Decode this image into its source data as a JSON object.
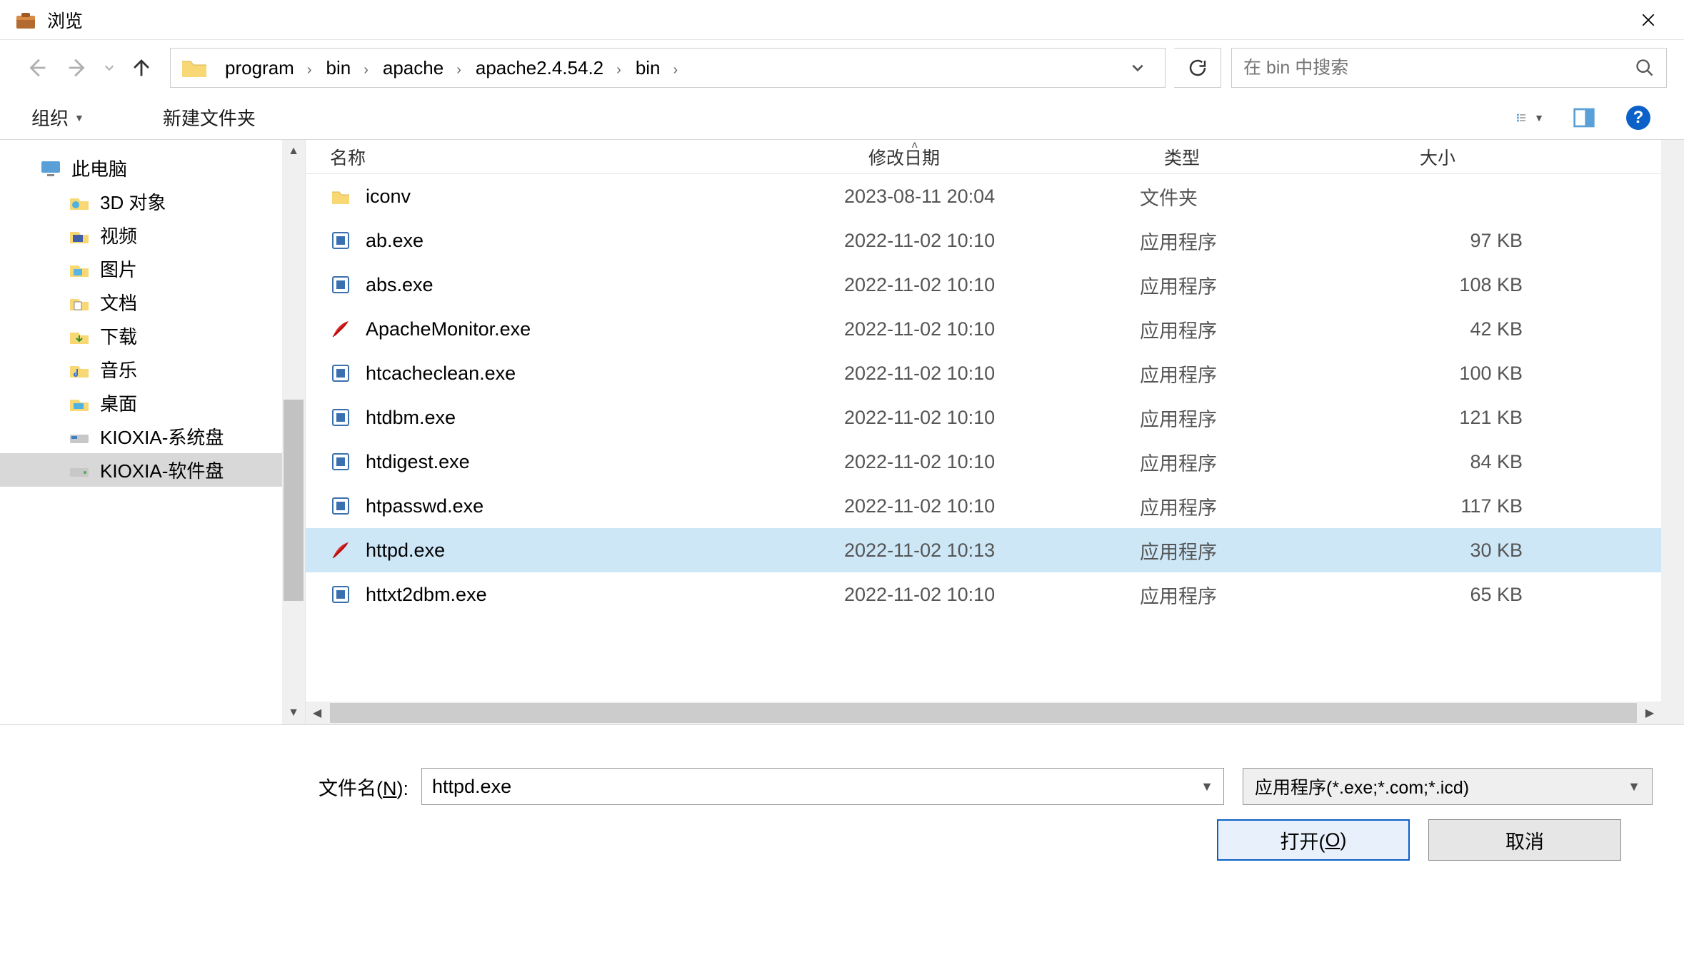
{
  "title": "浏览",
  "breadcrumbs": [
    "program",
    "bin",
    "apache",
    "apache2.4.54.2",
    "bin"
  ],
  "search_placeholder": "在 bin 中搜索",
  "toolbar": {
    "organize": "组织",
    "new_folder": "新建文件夹"
  },
  "columns": {
    "name": "名称",
    "date": "修改日期",
    "type": "类型",
    "size": "大小"
  },
  "tree": {
    "root": "此电脑",
    "items": [
      {
        "label": "3D 对象",
        "icon": "3d"
      },
      {
        "label": "视频",
        "icon": "video"
      },
      {
        "label": "图片",
        "icon": "pictures"
      },
      {
        "label": "文档",
        "icon": "documents"
      },
      {
        "label": "下载",
        "icon": "downloads"
      },
      {
        "label": "音乐",
        "icon": "music"
      },
      {
        "label": "桌面",
        "icon": "desktop"
      },
      {
        "label": "KIOXIA-系统盘",
        "icon": "ssd"
      },
      {
        "label": "KIOXIA-软件盘",
        "icon": "drive",
        "selected": true
      }
    ]
  },
  "files": [
    {
      "name": "iconv",
      "date": "2023-08-11 20:04",
      "type": "文件夹",
      "size": "",
      "icon": "folder"
    },
    {
      "name": "ab.exe",
      "date": "2022-11-02 10:10",
      "type": "应用程序",
      "size": "97 KB",
      "icon": "exe"
    },
    {
      "name": "abs.exe",
      "date": "2022-11-02 10:10",
      "type": "应用程序",
      "size": "108 KB",
      "icon": "exe"
    },
    {
      "name": "ApacheMonitor.exe",
      "date": "2022-11-02 10:10",
      "type": "应用程序",
      "size": "42 KB",
      "icon": "feather"
    },
    {
      "name": "htcacheclean.exe",
      "date": "2022-11-02 10:10",
      "type": "应用程序",
      "size": "100 KB",
      "icon": "exe"
    },
    {
      "name": "htdbm.exe",
      "date": "2022-11-02 10:10",
      "type": "应用程序",
      "size": "121 KB",
      "icon": "exe"
    },
    {
      "name": "htdigest.exe",
      "date": "2022-11-02 10:10",
      "type": "应用程序",
      "size": "84 KB",
      "icon": "exe"
    },
    {
      "name": "htpasswd.exe",
      "date": "2022-11-02 10:10",
      "type": "应用程序",
      "size": "117 KB",
      "icon": "exe"
    },
    {
      "name": "httpd.exe",
      "date": "2022-11-02 10:13",
      "type": "应用程序",
      "size": "30 KB",
      "icon": "feather",
      "selected": true
    },
    {
      "name": "httxt2dbm.exe",
      "date": "2022-11-02 10:10",
      "type": "应用程序",
      "size": "65 KB",
      "icon": "exe"
    }
  ],
  "filename": {
    "label_pre": "文件名(",
    "label_u": "N",
    "label_post": "):",
    "value": "httpd.exe"
  },
  "filter": "应用程序(*.exe;*.com;*.icd)",
  "buttons": {
    "open_pre": "打开(",
    "open_u": "O",
    "open_post": ")",
    "cancel": "取消"
  }
}
